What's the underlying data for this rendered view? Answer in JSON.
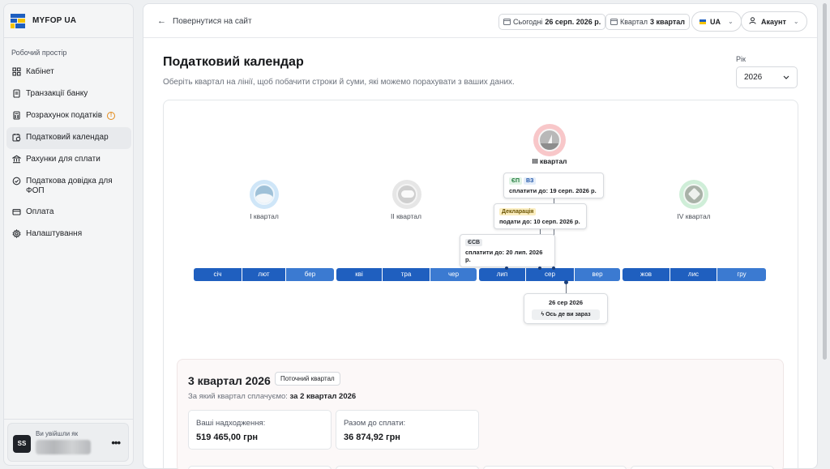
{
  "brand": {
    "name": "MYFOP UA"
  },
  "sidebar": {
    "workspace_label": "Робочий простір",
    "items": [
      {
        "label": "Кабінет",
        "icon": "grid-icon"
      },
      {
        "label": "Транзакції банку",
        "icon": "document-icon"
      },
      {
        "label": "Розрахунок податків",
        "icon": "calculator-icon",
        "warning": "!"
      },
      {
        "label": "Податковий календар",
        "icon": "calendar-clock-icon",
        "active": true
      },
      {
        "label": "Рахунки для сплати",
        "icon": "bank-icon"
      },
      {
        "label": "Податкова довідка для ФОП",
        "icon": "check-circle-icon"
      },
      {
        "label": "Оплата",
        "icon": "card-icon"
      },
      {
        "label": "Налаштування",
        "icon": "gear-icon"
      }
    ],
    "user": {
      "logged_as": "Ви увійшли як",
      "initials": "SS",
      "more": "•••"
    }
  },
  "topbar": {
    "back_label": "Повернутися на сайт",
    "today_label": "Сьогодні",
    "today_value": "26 серп. 2026 р.",
    "quarter_label": "Квартал",
    "quarter_value": "3 квартал",
    "lang": "UA",
    "account": "Акаунт"
  },
  "page": {
    "title": "Податковий календар",
    "subtitle": "Оберіть квартал на лінії, щоб побачити строки й суми, які можемо порахувати з ваших даних.",
    "year_label": "Рік",
    "year_value": "2026"
  },
  "timeline": {
    "quarters": [
      {
        "label": "I квартал",
        "theme": "winter"
      },
      {
        "label": "II квартал",
        "theme": "spring"
      },
      {
        "label": "III квартал",
        "theme": "summer",
        "current": true
      },
      {
        "label": "IV квартал",
        "theme": "autumn"
      }
    ],
    "months": [
      "січ",
      "лют",
      "бер",
      "кві",
      "тра",
      "чер",
      "лип",
      "сер",
      "вер",
      "жов",
      "лис",
      "гру"
    ],
    "deadlines": [
      {
        "tags": [
          "ЄП",
          "ВЗ"
        ],
        "text": "сплатити до: 19 серп. 2026 р."
      },
      {
        "tags": [
          "Декларація"
        ],
        "text": "подати до: 10 серп. 2026 р."
      },
      {
        "tags": [
          "ЄСВ"
        ],
        "text": "сплатити до: 20 лип. 2026 р."
      }
    ],
    "today": {
      "date": "26 сер 2026",
      "here_label": "Ось де ви зараз"
    }
  },
  "summary": {
    "title": "3 квартал 2026",
    "badge": "Поточний квартал",
    "for_label": "За який квартал сплачуємо:",
    "for_value": "за 2 квартал 2026",
    "income_label": "Ваші надходження:",
    "income_value": "519 465,00 грн",
    "total_label": "Разом до сплати:",
    "total_value": "36 874,92 грн"
  }
}
